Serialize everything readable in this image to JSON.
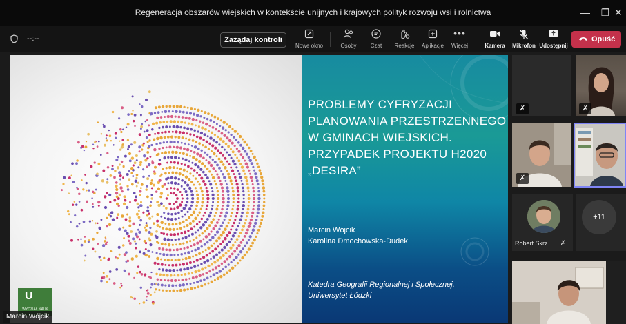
{
  "window": {
    "title": "Regeneracja obszarów wiejskich w kontekście unijnych i krajowych polityk rozwoju wsi i rolnictwa",
    "minimize": "—",
    "restore": "❐",
    "close": "✕"
  },
  "toolbar": {
    "timer": "--:--",
    "request_control": "Zażądaj kontroli",
    "items": [
      {
        "label": "Nowe okno",
        "icon": "new-window-icon"
      },
      {
        "label": "Osoby",
        "icon": "people-icon"
      },
      {
        "label": "Czat",
        "icon": "chat-icon"
      },
      {
        "label": "Reakcje",
        "icon": "reactions-icon"
      },
      {
        "label": "Aplikacje",
        "icon": "apps-icon"
      },
      {
        "label": "Więcej",
        "icon": "more-icon"
      },
      {
        "label": "Kamera",
        "icon": "camera-icon"
      },
      {
        "label": "Mikrofon",
        "icon": "mic-off-icon"
      },
      {
        "label": "Udostępnij",
        "icon": "share-icon"
      }
    ],
    "leave": "Opuść"
  },
  "slide": {
    "title": "PROBLEMY CYFRYZACJI PLANOWANIA PRZESTRZENNEGO W GMINACH WIEJSKICH. PRZYPADEK PROJEKTU H2020 „DESIRA”",
    "author1": "Marcin Wójcik",
    "author2": "Karolina Dmochowska-Dudek",
    "affil1": "Katedra Geografii Regionalnej i Społecznej,",
    "affil2": "Uniwersytet Łódzki",
    "logo_letter": "U",
    "logo_text": "WYDZIAŁ NAUK"
  },
  "presenter": "Marcin Wójcik",
  "participants": {
    "extra_count": "+11",
    "robert": "Robert Skrz..."
  },
  "colors": {
    "leave": "#c4314b",
    "accent": "#6264a7"
  }
}
